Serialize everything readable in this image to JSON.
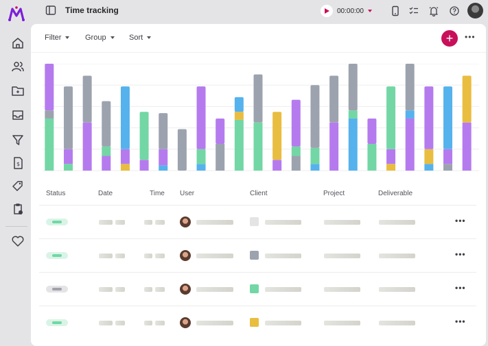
{
  "header": {
    "title": "Time tracking",
    "timer": "00:00:00"
  },
  "sidebar": {
    "items": [
      {
        "icon": "home-icon"
      },
      {
        "icon": "users-icon"
      },
      {
        "icon": "folder-icon"
      },
      {
        "icon": "inbox-icon"
      },
      {
        "icon": "filter-icon"
      },
      {
        "icon": "invoice-icon"
      },
      {
        "icon": "tag-icon"
      },
      {
        "icon": "clipboard-clock-icon"
      },
      {
        "icon": "heart-icon"
      }
    ]
  },
  "toolbar": {
    "filter_label": "Filter",
    "group_label": "Group",
    "sort_label": "Sort"
  },
  "colors": {
    "accent": "#c8105a",
    "purple": "#b57bee",
    "gray": "#9ca3af",
    "green": "#72d7a5",
    "blue": "#56b2ec",
    "yellow": "#e9bd3f"
  },
  "chart_data": {
    "type": "bar",
    "stacked": true,
    "grid": true,
    "ylim": [
      0,
      160
    ],
    "series_colors": [
      "green",
      "gray",
      "purple",
      "blue",
      "yellow"
    ],
    "bars": [
      [
        [
          "green",
          78
        ],
        [
          "gray",
          12
        ],
        [
          "purple",
          70
        ]
      ],
      [
        [
          "green",
          10
        ],
        [
          "purple",
          22
        ],
        [
          "gray",
          94
        ]
      ],
      [
        [
          "purple",
          72
        ],
        [
          "gray",
          70
        ]
      ],
      [
        [
          "purple",
          22
        ],
        [
          "green",
          14
        ],
        [
          "gray",
          68
        ]
      ],
      [
        [
          "yellow",
          10
        ],
        [
          "purple",
          22
        ],
        [
          "blue",
          94
        ]
      ],
      [
        [
          "purple",
          16
        ],
        [
          "green",
          72
        ]
      ],
      [
        [
          "blue",
          8
        ],
        [
          "purple",
          24
        ],
        [
          "gray",
          54
        ]
      ],
      [
        [
          "gray",
          62
        ]
      ],
      [
        [
          "blue",
          10
        ],
        [
          "green",
          22
        ],
        [
          "purple",
          94
        ]
      ],
      [
        [
          "gray",
          40
        ],
        [
          "purple",
          38
        ]
      ],
      [
        [
          "green",
          76
        ],
        [
          "yellow",
          12
        ],
        [
          "blue",
          22
        ]
      ],
      [
        [
          "green",
          72
        ],
        [
          "gray",
          72
        ]
      ],
      [
        [
          "purple",
          16
        ],
        [
          "yellow",
          72
        ]
      ],
      [
        [
          "gray",
          22
        ],
        [
          "green",
          14
        ],
        [
          "purple",
          70
        ]
      ],
      [
        [
          "blue",
          10
        ],
        [
          "green",
          24
        ],
        [
          "gray",
          94
        ]
      ],
      [
        [
          "purple",
          72
        ],
        [
          "gray",
          70
        ]
      ],
      [
        [
          "blue",
          78
        ],
        [
          "green",
          12
        ],
        [
          "gray",
          70
        ]
      ],
      [
        [
          "green",
          40
        ],
        [
          "purple",
          38
        ]
      ],
      [
        [
          "yellow",
          10
        ],
        [
          "purple",
          22
        ],
        [
          "green",
          94
        ]
      ],
      [
        [
          "purple",
          78
        ],
        [
          "blue",
          12
        ],
        [
          "gray",
          70
        ]
      ],
      [
        [
          "blue",
          10
        ],
        [
          "yellow",
          22
        ],
        [
          "purple",
          94
        ]
      ],
      [
        [
          "gray",
          10
        ],
        [
          "purple",
          22
        ],
        [
          "blue",
          94
        ]
      ],
      [
        [
          "purple",
          72
        ],
        [
          "yellow",
          70
        ]
      ]
    ]
  },
  "table": {
    "columns": [
      "Status",
      "Date",
      "Time",
      "User",
      "Client",
      "Project",
      "Deliverable"
    ],
    "rows": [
      {
        "status_color": "green",
        "client_color": "#e4e4e4"
      },
      {
        "status_color": "green",
        "client_color": "#9ca3af"
      },
      {
        "status_color": "gray",
        "client_color": "#72d7a5"
      },
      {
        "status_color": "green",
        "client_color": "#e9bd3f"
      }
    ]
  }
}
